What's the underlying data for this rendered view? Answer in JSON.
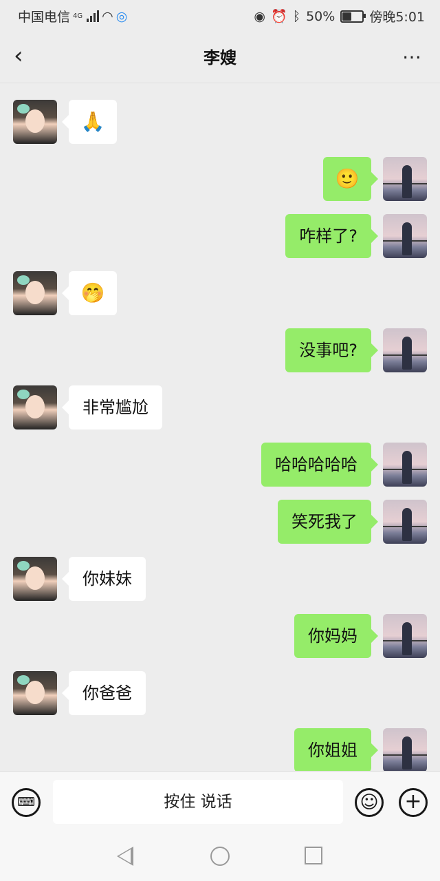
{
  "status_bar": {
    "carrier": "中国电信",
    "network": "4G",
    "battery": "50%",
    "battery_level": 0.5,
    "time": "傍晚5:01",
    "icons": [
      "signal-icon",
      "wifi-icon",
      "app-notification-icon",
      "eye-icon",
      "alarm-icon",
      "bluetooth-icon",
      "battery-icon"
    ]
  },
  "header": {
    "title": "李嫂",
    "back_icon": "chevron-left-icon",
    "more_icon": "more-dots-icon"
  },
  "messages": [
    {
      "side": "left",
      "text": "🙏",
      "kind": "emoji"
    },
    {
      "side": "right",
      "text": "🙂",
      "kind": "emoji"
    },
    {
      "side": "right",
      "text": "咋样了?",
      "kind": "text"
    },
    {
      "side": "left",
      "text": "🤭",
      "kind": "emoji"
    },
    {
      "side": "right",
      "text": "没事吧?",
      "kind": "text"
    },
    {
      "side": "left",
      "text": "非常尴尬",
      "kind": "text"
    },
    {
      "side": "right",
      "text": "哈哈哈哈哈",
      "kind": "text"
    },
    {
      "side": "right",
      "text": "笑死我了",
      "kind": "text"
    },
    {
      "side": "left",
      "text": "你妹妹",
      "kind": "text"
    },
    {
      "side": "right",
      "text": "你妈妈",
      "kind": "text"
    },
    {
      "side": "left",
      "text": "你爸爸",
      "kind": "text"
    },
    {
      "side": "right",
      "text": "你姐姐",
      "kind": "text"
    }
  ],
  "input_bar": {
    "voice_label": "按住 说话",
    "keyboard_icon": "keyboard-icon",
    "emoji_icon": "smiley-icon",
    "plus_icon": "plus-icon"
  },
  "system_nav": {
    "icons": [
      "back-triangle-icon",
      "home-circle-icon",
      "recents-square-icon"
    ]
  },
  "colors": {
    "background": "#ededed",
    "my_bubble": "#95ec69",
    "their_bubble": "#ffffff"
  }
}
